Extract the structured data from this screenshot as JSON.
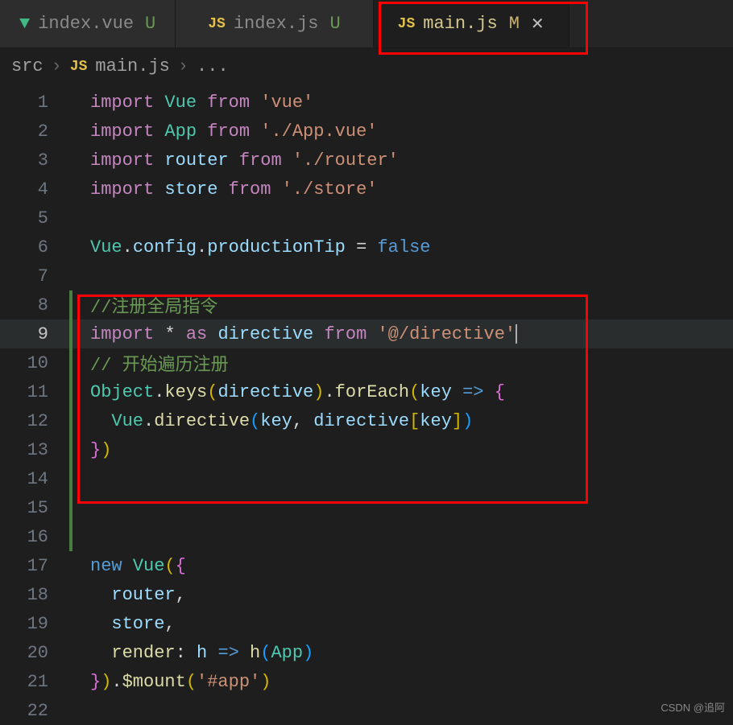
{
  "tabs": [
    {
      "icon": "vue",
      "name": "index.vue",
      "status": "U",
      "active": false
    },
    {
      "icon": "js",
      "name": "index.js",
      "status": "U",
      "active": false
    },
    {
      "icon": "js",
      "name": "main.js",
      "status": "M",
      "active": true
    }
  ],
  "breadcrumb": {
    "folder": "src",
    "file": "main.js",
    "more": "..."
  },
  "lines": {
    "l1_import": "import",
    "l1_cls": "Vue",
    "l1_from": "from",
    "l1_str": "'vue'",
    "l2_import": "import",
    "l2_cls": "App",
    "l2_from": "from",
    "l2_str": "'./App.vue'",
    "l3_import": "import",
    "l3_var": "router",
    "l3_from": "from",
    "l3_str": "'./router'",
    "l4_import": "import",
    "l4_var": "store",
    "l4_from": "from",
    "l4_str": "'./store'",
    "l6_vue": "Vue",
    "l6_config": "config",
    "l6_prod": "productionTip",
    "l6_eq": " = ",
    "l6_false": "false",
    "l8_cmt": "//注册全局指令",
    "l9_import": "import",
    "l9_star": " * ",
    "l9_as": "as",
    "l9_dir": "directive",
    "l9_from": "from",
    "l9_str": "'@/directive'",
    "l10_cmt": "// 开始遍历注册",
    "l11_obj": "Object",
    "l11_keys": "keys",
    "l11_dir": "directive",
    "l11_foreach": "forEach",
    "l11_key": "key",
    "l11_arrow": "=>",
    "l12_vue": "Vue",
    "l12_dirfn": "directive",
    "l12_key": "key",
    "l12_dir": "directive",
    "l12_key2": "key",
    "l17_new": "new",
    "l17_vue": "Vue",
    "l18_router": "router",
    "l19_store": "store",
    "l20_render": "render",
    "l20_h": "h",
    "l20_arrow": "=>",
    "l20_h2": "h",
    "l20_app": "App",
    "l21_mount": "$mount",
    "l21_str": "'#app'"
  },
  "line_numbers": [
    "1",
    "2",
    "3",
    "4",
    "5",
    "6",
    "7",
    "8",
    "9",
    "10",
    "11",
    "12",
    "13",
    "14",
    "15",
    "16",
    "17",
    "18",
    "19",
    "20",
    "21",
    "22"
  ],
  "watermark": "CSDN @追阿"
}
